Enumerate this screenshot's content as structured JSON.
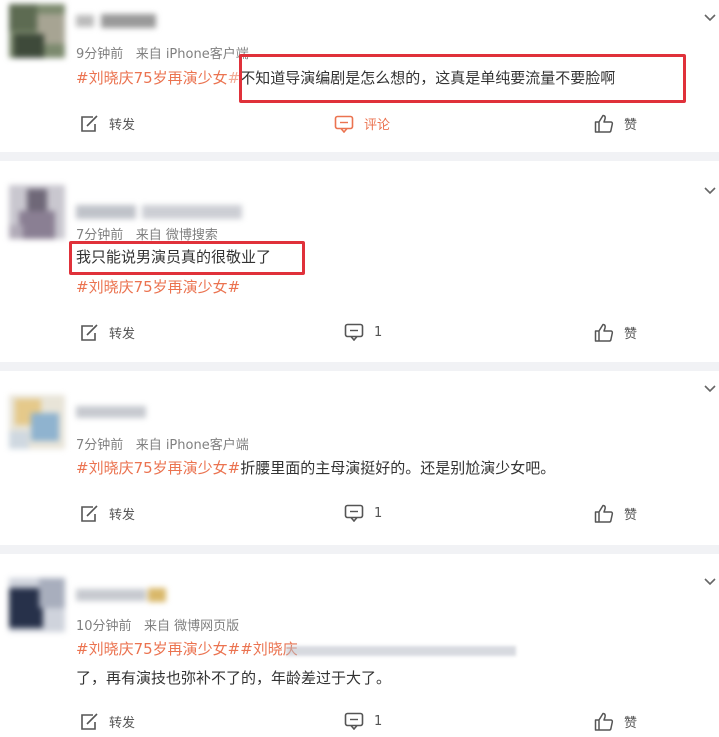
{
  "posts": [
    {
      "meta_time": "9分钟前",
      "meta_source": "来自 iPhone客户端",
      "hashtag": "#刘晓庆75岁再演少女",
      "hashtag_tail": "#",
      "body": "不知道导演编剧是怎么想的，这真是单纯要流量不要脸啊",
      "repost": "转发",
      "comment": "评论",
      "like": "赞"
    },
    {
      "meta_time": "7分钟前",
      "meta_source": "来自 微博搜索",
      "body": "我只能说男演员真的很敬业了",
      "hashtag": "#刘晓庆75岁再演少女#",
      "repost": "转发",
      "comment_count": "1",
      "like": "赞"
    },
    {
      "meta_time": "7分钟前",
      "meta_source": "来自 iPhone客户端",
      "hashtag": "#刘晓庆75岁再演少女#",
      "body": "折腰里面的主母演挺好的。还是别尬演少女吧。",
      "repost": "转发",
      "comment_count": "1",
      "like": "赞"
    },
    {
      "meta_time": "10分钟前",
      "meta_source": "来自 微博网页版",
      "hashtag": "#刘晓庆75岁再演少女#",
      "hashtag2": "#刘晓庆",
      "body": "了，再有演技也弥补不了的，年龄差过于大了。",
      "repost": "转发",
      "comment_count": "1",
      "like": "赞"
    }
  ],
  "icons": {
    "repost": "repost-icon",
    "comment": "comment-icon",
    "like": "thumbs-up-icon",
    "more": "chevron-down-icon"
  },
  "colors": {
    "hashtag": "#eb7350",
    "highlight": "#e0313a",
    "meta": "#808080",
    "separator": "#f1f2f5"
  }
}
